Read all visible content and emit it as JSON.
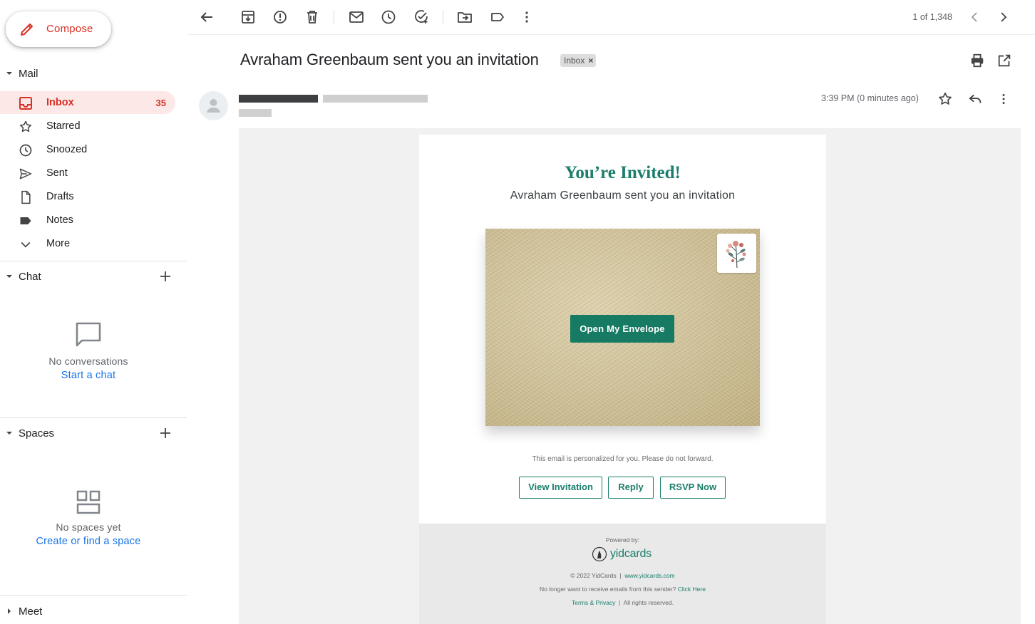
{
  "sidebar": {
    "compose_label": "Compose",
    "mail_header": "Mail",
    "items": [
      {
        "label": "Inbox",
        "count": "35",
        "icon": "inbox-icon"
      },
      {
        "label": "Starred",
        "icon": "star-icon"
      },
      {
        "label": "Snoozed",
        "icon": "clock-icon"
      },
      {
        "label": "Sent",
        "icon": "send-icon"
      },
      {
        "label": "Drafts",
        "icon": "draft-icon"
      },
      {
        "label": "Notes",
        "icon": "label-icon"
      },
      {
        "label": "More",
        "icon": "chevron-down-icon"
      }
    ],
    "chat": {
      "header": "Chat",
      "empty_msg": "No conversations",
      "link": "Start a chat"
    },
    "spaces": {
      "header": "Spaces",
      "empty_msg": "No spaces yet",
      "link": "Create or find a space"
    },
    "meet_header": "Meet"
  },
  "toolbar": {
    "pager": "1 of 1,348"
  },
  "message": {
    "subject": "Avraham Greenbaum sent you an invitation",
    "label_chip": "Inbox",
    "label_chip_close": "×",
    "time": "3:39 PM (0 minutes ago)"
  },
  "email": {
    "heading": "You’re Invited!",
    "subheading": "Avraham Greenbaum sent you an invitation",
    "open_button": "Open My Envelope",
    "personal_note": "This email is personalized for you. Please do not forward.",
    "buttons": [
      "View Invitation",
      "Reply",
      "RSVP Now"
    ],
    "footer": {
      "powered_by": "Powered by:",
      "brand": "yidcards",
      "copyright": "© 2022 YidCards",
      "separator": "|",
      "site": "www.yidcards.com",
      "unsubscribe_text": "No longer want to receive emails from this sender?",
      "unsubscribe_link": "Click Here",
      "terms": "Terms & Privacy",
      "rights": "All rights reserved."
    }
  },
  "colors": {
    "accent_red": "#d93025",
    "brand_green": "#1b7e6c",
    "link_blue": "#1a73e8"
  }
}
